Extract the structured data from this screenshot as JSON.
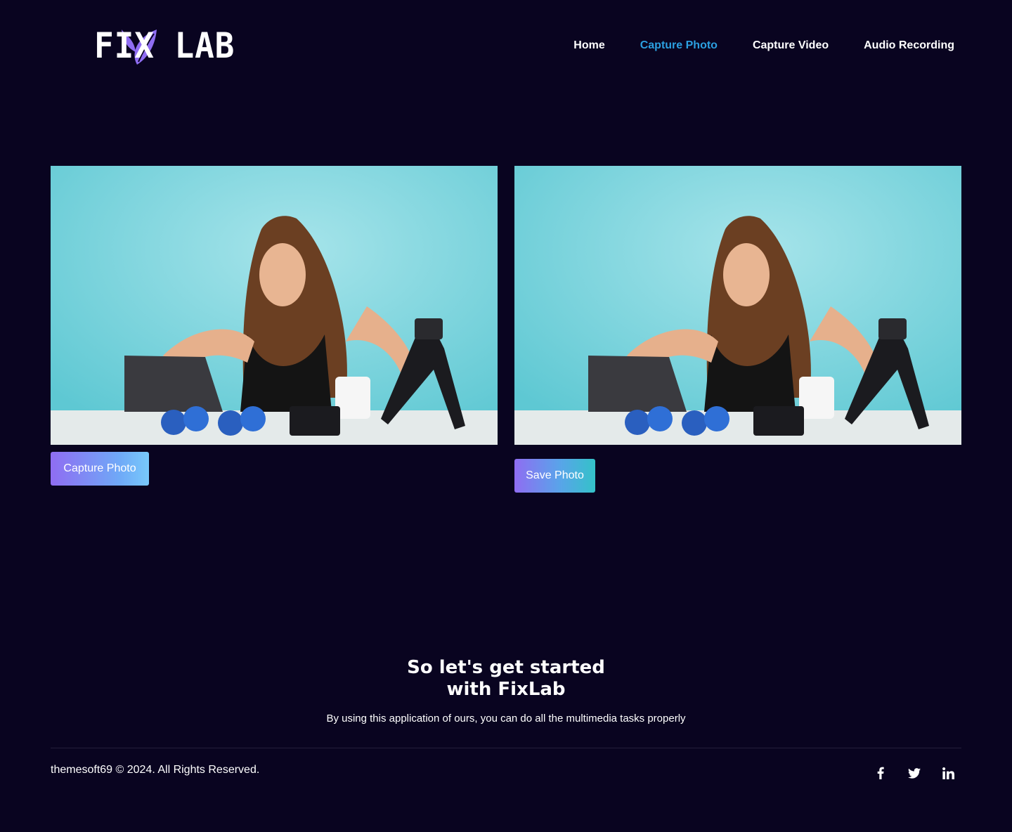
{
  "brand": {
    "name": "FIX LAB",
    "logo_color": "#8f6df2"
  },
  "nav": {
    "items": [
      {
        "label": "Home"
      },
      {
        "label": "Capture Photo"
      },
      {
        "label": "Capture Video"
      },
      {
        "label": "Audio Recording"
      }
    ],
    "active_index": 1,
    "active_color": "#2b9fe0"
  },
  "preview": {
    "live_image_icon": "photo-live-feed",
    "captured_image_icon": "photo-captured"
  },
  "buttons": {
    "capture_label": "Capture Photo",
    "save_label": "Save Photo"
  },
  "cta": {
    "title_line1": "So let's get started",
    "title_line2": "with FixLab",
    "subtitle": "By using this application of ours, you can do all the multimedia tasks properly"
  },
  "footer": {
    "copyright": "themesoft69 © 2024. All Rights Reserved.",
    "social": [
      "facebook-icon",
      "twitter-icon",
      "linkedin-icon"
    ]
  },
  "colors": {
    "background": "#090420",
    "button_gradient_start": "#8f6df2",
    "button_gradient_end": "#78c9fb"
  }
}
